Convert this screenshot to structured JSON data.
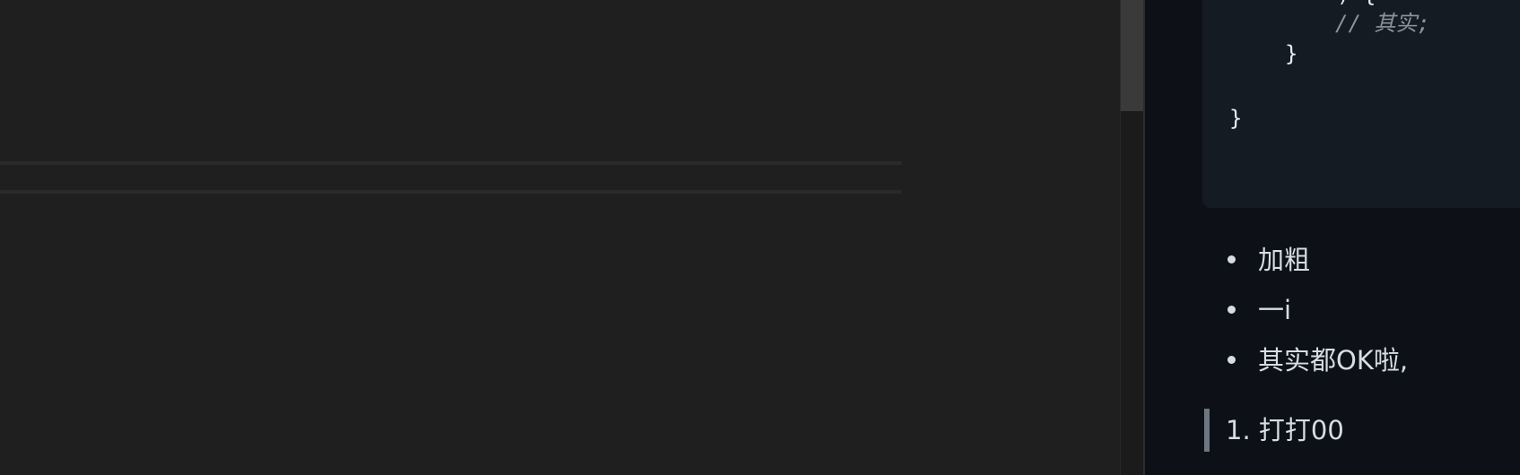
{
  "editor": {},
  "preview": {
    "code_lines": {
      "partial_top": ") {",
      "comment": "// 其实;",
      "inner_close": "}",
      "outer_close": "}"
    },
    "bullets": [
      "加粗",
      "一i",
      "其实都OK啦,"
    ],
    "quote_item": "1. 打打00"
  },
  "colors": {
    "editor_bg": "#1f1f1f",
    "preview_bg": "#0d1117",
    "code_bg": "#151b23",
    "text": "#d6dde6",
    "comment": "#8b949e"
  }
}
